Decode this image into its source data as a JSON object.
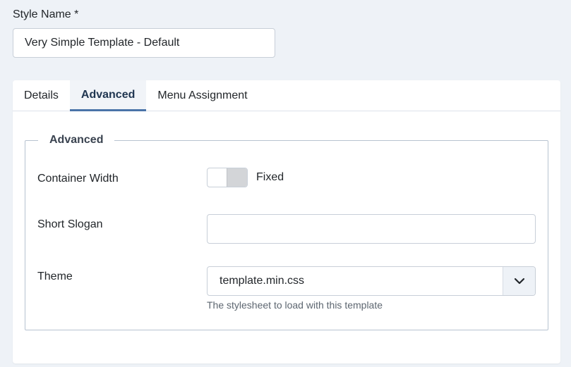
{
  "style_name": {
    "label": "Style Name *",
    "value": "Very Simple Template - Default"
  },
  "tabs": [
    {
      "label": "Details",
      "active": false
    },
    {
      "label": "Advanced",
      "active": true
    },
    {
      "label": "Menu Assignment",
      "active": false
    }
  ],
  "advanced": {
    "legend": "Advanced",
    "container_width": {
      "label": "Container Width",
      "switch_text": "Fixed",
      "on": false
    },
    "short_slogan": {
      "label": "Short Slogan",
      "value": "",
      "placeholder": ""
    },
    "theme": {
      "label": "Theme",
      "selected": "template.min.css",
      "hint": "The stylesheet to load with this template"
    }
  },
  "icons": {
    "select_arrow": "chevron-down-icon"
  },
  "colors": {
    "page_bg": "#eef2f7",
    "active_tab_underline": "#4a74a8",
    "active_tab_text": "#1f3550",
    "border": "#c8cfd8"
  }
}
